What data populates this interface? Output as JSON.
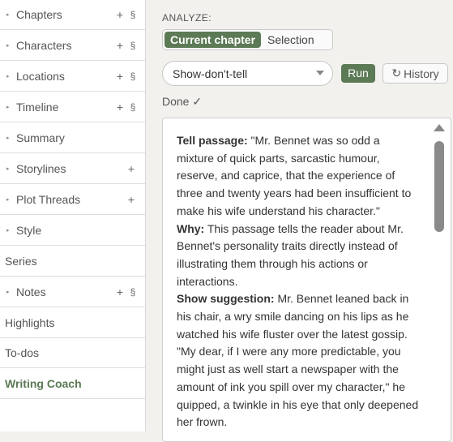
{
  "sidebar": {
    "items": [
      {
        "label": "Chapters",
        "chevron": true,
        "plus": true,
        "section": true
      },
      {
        "label": "Characters",
        "chevron": true,
        "plus": true,
        "section": true
      },
      {
        "label": "Locations",
        "chevron": true,
        "plus": true,
        "section": true
      },
      {
        "label": "Timeline",
        "chevron": true,
        "plus": true,
        "section": true
      },
      {
        "label": "Summary",
        "chevron": true,
        "plus": false,
        "section": false
      },
      {
        "label": "Storylines",
        "chevron": true,
        "plus": true,
        "section": false
      },
      {
        "label": "Plot Threads",
        "chevron": true,
        "plus": true,
        "section": false
      },
      {
        "label": "Style",
        "chevron": true,
        "plus": false,
        "section": false
      },
      {
        "label": "Series",
        "chevron": false,
        "plus": false,
        "section": false
      },
      {
        "label": "Notes",
        "chevron": true,
        "plus": true,
        "section": true
      },
      {
        "label": "Highlights",
        "chevron": false,
        "plus": false,
        "section": false
      },
      {
        "label": "To-dos",
        "chevron": false,
        "plus": false,
        "section": false
      },
      {
        "label": "Writing Coach",
        "chevron": false,
        "plus": false,
        "section": false,
        "active": true
      }
    ],
    "chevron_glyph": "▸",
    "plus_glyph": "+",
    "section_glyph": "§"
  },
  "analyze": {
    "label": "ANALYZE:",
    "scope_active": "Current chapter",
    "scope_other": "Selection"
  },
  "tool": {
    "selected": "Show-don't-tell",
    "run_label": "Run",
    "history_label": "History",
    "history_icon": "↻",
    "status": "Done ✓"
  },
  "result": {
    "tell_label": "Tell passage:",
    "tell_text": " \"Mr. Bennet was so odd a mixture of quick parts, sarcastic humour, reserve, and caprice, that the experience of three and twenty years had been insufficient to make his wife understand his character.\"",
    "why_label": "Why:",
    "why_text": " This passage tells the reader about Mr. Bennet's personality traits directly instead of illustrating them through his actions or interactions.",
    "show_label": "Show suggestion:",
    "show_text": " Mr. Bennet leaned back in his chair, a wry smile dancing on his lips as he watched his wife fluster over the latest gossip. \"My dear, if I were any more predictable, you might just as well start a newspaper with the amount of ink you spill over my character,\" he quipped, a twinkle in his eye that only deepened her frown."
  },
  "colors": {
    "accent": "#5b7a55",
    "background": "#f2f1ee",
    "sidebar": "#ffffff"
  }
}
